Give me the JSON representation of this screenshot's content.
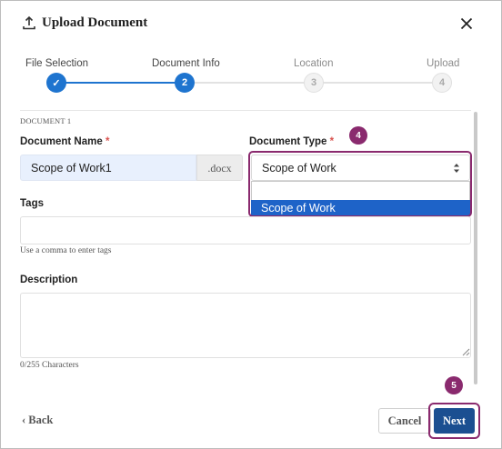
{
  "dialog": {
    "title": "Upload Document"
  },
  "stepper": {
    "steps": [
      {
        "label": "File Selection",
        "marker": "✓",
        "state": "done"
      },
      {
        "label": "Document Info",
        "marker": "2",
        "state": "active"
      },
      {
        "label": "Location",
        "marker": "3",
        "state": "todo"
      },
      {
        "label": "Upload",
        "marker": "4",
        "state": "todo"
      }
    ]
  },
  "form": {
    "section": "DOCUMENT 1",
    "document_name": {
      "label": "Document Name",
      "required_mark": "*",
      "value": "Scope of Work1",
      "extension": ".docx"
    },
    "document_type": {
      "label": "Document Type",
      "required_mark": "*",
      "value": "Scope of Work",
      "options": [
        "",
        "Scope of Work"
      ],
      "highlighted_option": "Scope of Work"
    },
    "tags": {
      "label": "Tags",
      "value": "",
      "help": "Use a comma to enter tags"
    },
    "description": {
      "label": "Description",
      "value": "",
      "counter": "0/255 Characters"
    }
  },
  "annotations": {
    "step_badge_a": "4",
    "step_badge_b": "5",
    "color": "#8a2a6e"
  },
  "footer": {
    "back_label": "Back",
    "cancel_label": "Cancel",
    "next_label": "Next"
  },
  "colors": {
    "primary": "#1e74cf",
    "next_button": "#1b4f91",
    "dropdown_highlight": "#1e63c8"
  }
}
